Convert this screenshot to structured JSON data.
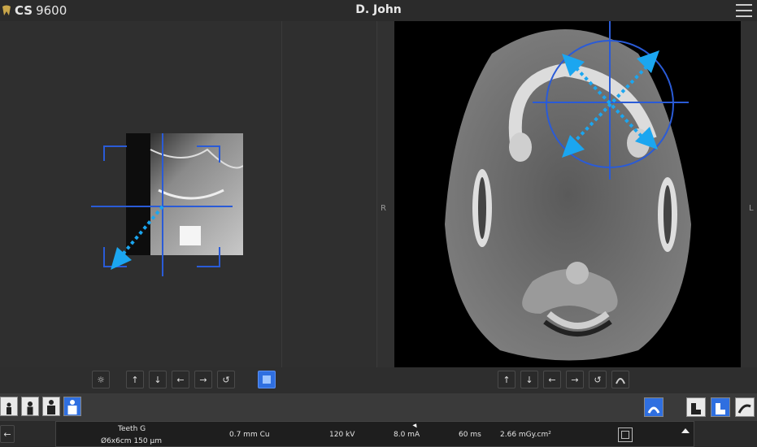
{
  "app": {
    "brand": "CS",
    "model": "9600"
  },
  "patient": {
    "name": "D. John"
  },
  "axial_view": {
    "left_label": "R",
    "right_label": "L"
  },
  "left_toolbar": {
    "buttons": [
      {
        "name": "brightness-icon",
        "glyph": "☼"
      },
      {
        "name": "arrow-up-icon",
        "glyph": "↑"
      },
      {
        "name": "arrow-down-icon",
        "glyph": "↓"
      },
      {
        "name": "arrow-left-icon",
        "glyph": "←"
      },
      {
        "name": "arrow-right-icon",
        "glyph": "→"
      },
      {
        "name": "reset-icon",
        "glyph": "↺"
      }
    ]
  },
  "right_toolbar": {
    "buttons": [
      {
        "name": "arrow-up-icon",
        "glyph": "↑"
      },
      {
        "name": "arrow-down-icon",
        "glyph": "↓"
      },
      {
        "name": "arrow-left-icon",
        "glyph": "←"
      },
      {
        "name": "arrow-right-icon",
        "glyph": "→"
      },
      {
        "name": "reset-icon",
        "glyph": "↺"
      }
    ]
  },
  "exposure": {
    "region": "Teeth G",
    "fov": "Ø6x6cm 150 µm",
    "filter": "0.7 mm Cu",
    "kv": "120 kV",
    "ma": "8.0 mA",
    "time": "60 ms",
    "dose": "2.66 mGy.cm²"
  },
  "colors": {
    "accent": "#2f6fe0",
    "crosshair": "#2a5bd7",
    "arrow": "#1ba6f0"
  }
}
